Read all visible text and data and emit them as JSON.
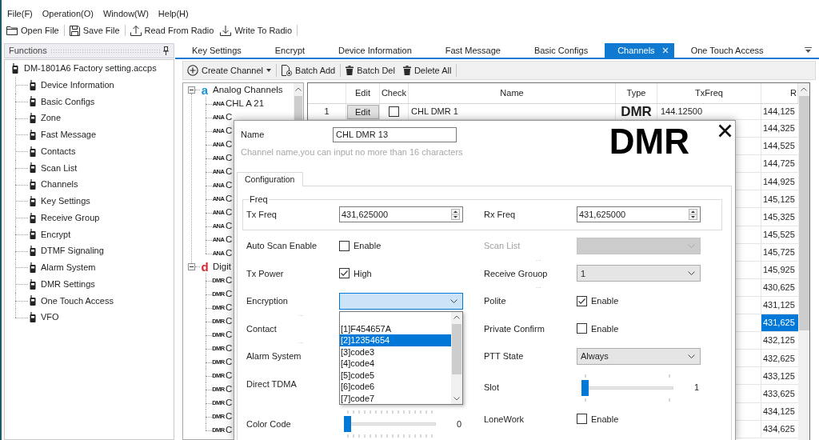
{
  "menu": [
    {
      "label": "File(F)"
    },
    {
      "label": "Operation(O)"
    },
    {
      "label": "Window(W)"
    },
    {
      "label": "Help(H)"
    }
  ],
  "toolbar": [
    {
      "label": "Open File",
      "kind": "open",
      "separator_after": true
    },
    {
      "label": "Save File",
      "kind": "save",
      "separator_after": true
    },
    {
      "label": "Read From Radio",
      "kind": "read",
      "separator_after": false
    },
    {
      "label": "Write To Radio",
      "kind": "write",
      "separator_after": true
    }
  ],
  "functions_panel": {
    "title": "Functions",
    "root": {
      "label": "DM-1801A6 Factory setting.accps",
      "children": [
        {
          "label": "Device Information"
        },
        {
          "label": "Basic Configs"
        },
        {
          "label": "Zone"
        },
        {
          "label": "Fast Message"
        },
        {
          "label": "Contacts"
        },
        {
          "label": "Scan List"
        },
        {
          "label": "Channels"
        },
        {
          "label": "Key Settings"
        },
        {
          "label": "Receive Group"
        },
        {
          "label": "Encrypt"
        },
        {
          "label": "DTMF Signaling"
        },
        {
          "label": "Alarm System"
        },
        {
          "label": "DMR Settings"
        },
        {
          "label": "One Touch Access"
        },
        {
          "label": "VFO"
        }
      ]
    }
  },
  "tabs": [
    {
      "label": "Key Settings",
      "selected": false
    },
    {
      "label": "Encrypt",
      "selected": false
    },
    {
      "label": "Device Information",
      "selected": false
    },
    {
      "label": "Fast Message",
      "selected": false
    },
    {
      "label": "Basic Configs",
      "selected": false
    },
    {
      "label": "Channels",
      "selected": true
    },
    {
      "label": "One Touch Access",
      "selected": false
    }
  ],
  "channel_toolbar": [
    {
      "label": "Create Channel",
      "kind": "create",
      "separator_after": true
    },
    {
      "label": "Batch Add",
      "kind": "batch_add",
      "separator_after": true
    },
    {
      "label": "Batch Del",
      "kind": "batch_del",
      "separator_after": false
    },
    {
      "label": "Delete All",
      "kind": "delete_all",
      "separator_after": true
    }
  ],
  "channel_tree": {
    "groups": [
      {
        "label": "Analog Channels",
        "badge": "a",
        "color": "#1a93d8",
        "expanded": true,
        "children": [
          {
            "label": "CHL A 21",
            "badge": "ANA"
          },
          {
            "label": "C",
            "badge": "ANA"
          },
          {
            "label": "C",
            "badge": "ANA"
          },
          {
            "label": "C",
            "badge": "ANA"
          },
          {
            "label": "C",
            "badge": "ANA"
          },
          {
            "label": "C",
            "badge": "ANA"
          },
          {
            "label": "C",
            "badge": "ANA"
          },
          {
            "label": "C",
            "badge": "ANA"
          },
          {
            "label": "C",
            "badge": "ANA"
          },
          {
            "label": "C",
            "badge": "ANA"
          },
          {
            "label": "C",
            "badge": "ANA"
          },
          {
            "label": "C",
            "badge": "ANA"
          }
        ]
      },
      {
        "label": "Digit",
        "badge": "d",
        "color": "#d8262e",
        "expanded": true,
        "children": [
          {
            "label": "C",
            "badge": "DMR"
          },
          {
            "label": "C",
            "badge": "DMR"
          },
          {
            "label": "C",
            "badge": "DMR"
          },
          {
            "label": "C",
            "badge": "DMR"
          },
          {
            "label": "C",
            "badge": "DMR"
          },
          {
            "label": "C",
            "badge": "DMR"
          },
          {
            "label": "C",
            "badge": "DMR"
          },
          {
            "label": "C",
            "badge": "DMR"
          },
          {
            "label": "C",
            "badge": "DMR"
          },
          {
            "label": "C",
            "badge": "DMR"
          },
          {
            "label": "C",
            "badge": "DMR"
          },
          {
            "label": "C",
            "badge": "DMR"
          }
        ]
      }
    ]
  },
  "channel_table": {
    "columns": [
      "Edit",
      "Check",
      "Name",
      "Type",
      "TxFreq",
      "R"
    ],
    "rows": [
      {
        "number": "1",
        "edit": "Edit",
        "checked": false,
        "name": "CHL DMR 1",
        "type": "DMR",
        "tx_freq": "144.12500",
        "column_7": "144,125",
        "selected": false
      },
      {
        "column_7": "144,325",
        "selected": false
      },
      {
        "column_7": "144,525",
        "selected": false
      },
      {
        "column_7": "144,725",
        "selected": false
      },
      {
        "column_7": "144,925",
        "selected": false
      },
      {
        "column_7": "145,125",
        "selected": false
      },
      {
        "column_7": "145,325",
        "selected": false
      },
      {
        "column_7": "145,525",
        "selected": false
      },
      {
        "column_7": "145,725",
        "selected": false
      },
      {
        "column_7": "145,925",
        "selected": false
      },
      {
        "column_7": "430,625",
        "selected": false
      },
      {
        "column_7": "431,125",
        "selected": false
      },
      {
        "column_7": "431,625",
        "selected": true
      },
      {
        "column_7": "432,125",
        "selected": false
      },
      {
        "column_7": "432,625",
        "selected": false
      },
      {
        "column_7": "433,125",
        "selected": false
      },
      {
        "column_7": "433,625",
        "selected": false
      },
      {
        "column_7": "434,125",
        "selected": false
      },
      {
        "column_7": "434,625",
        "selected": false
      }
    ]
  },
  "dialog": {
    "name_label": "Name",
    "name_value": "CHL DMR 13",
    "hint": "Channel name,you can input no more than 16 characters",
    "mode": "DMR",
    "tabs": [
      {
        "label": "Configuration",
        "selected": true
      }
    ],
    "freq": {
      "title": "Freq",
      "fields": [
        {
          "label": "Tx Freq",
          "value": "431,625000"
        },
        {
          "label": "Rx Freq",
          "value": "431,625000"
        }
      ]
    },
    "left_rows": [
      {
        "label": "Auto Scan Enable",
        "kind": "checkbox",
        "checked": false,
        "text": "Enable"
      },
      {
        "label": "Tx Power",
        "kind": "checkbox",
        "checked": true,
        "text": "High"
      },
      {
        "label": "Encryption",
        "kind": "combo",
        "disabled": false,
        "open": true,
        "note": "...",
        "options": [
          {
            "label": "[1]F454657A",
            "selected": false
          },
          {
            "label": "[2]12354654",
            "selected": true
          },
          {
            "label": "[3]code3",
            "selected": false
          },
          {
            "label": "[4]code4",
            "selected": false
          },
          {
            "label": "[5]code5",
            "selected": false
          },
          {
            "label": "[6]code6",
            "selected": false
          },
          {
            "label": "[7]code7",
            "selected": false
          }
        ]
      },
      {
        "label": "Contact",
        "kind": "label",
        "note": "..."
      },
      {
        "label": "Alarm System",
        "kind": "label"
      },
      {
        "label": "Direct TDMA",
        "kind": "label"
      },
      {
        "label": "Color Code",
        "kind": "slider",
        "level": 0,
        "reading": "0"
      }
    ],
    "right_rows": [
      {
        "label": "Scan List",
        "kind": "combo",
        "disabled": true,
        "open": false,
        "note": "..."
      },
      {
        "label": "Receive Grouop",
        "kind": "combo",
        "disabled": false,
        "open": false,
        "value": "1",
        "note": "..."
      },
      {
        "label": "Polite",
        "kind": "checkbox",
        "checked": true,
        "text": "Enable"
      },
      {
        "label": "Private Confirm",
        "kind": "checkbox",
        "checked": false,
        "text": "Enable"
      },
      {
        "label": "PTT State",
        "kind": "combo",
        "disabled": false,
        "open": false,
        "value": "Always"
      },
      {
        "label": "Slot",
        "kind": "toggle",
        "level": 0,
        "reading": "1"
      },
      {
        "label": "LoneWork",
        "kind": "checkbox",
        "checked": false,
        "text": "Enable"
      }
    ]
  }
}
